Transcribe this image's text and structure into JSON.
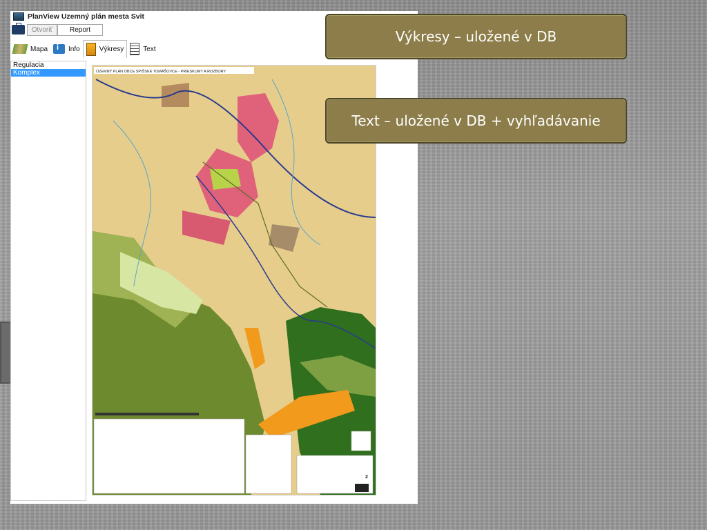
{
  "window": {
    "title": "PlanView Uzemný plán mesta Svit"
  },
  "toolbar": {
    "open_label": "Otvoriť",
    "report_label": "Report"
  },
  "tabs": [
    {
      "label": "Mapa",
      "icon": "map-icon"
    },
    {
      "label": "Info",
      "icon": "info-icon"
    },
    {
      "label": "Výkresy",
      "icon": "drawings-icon",
      "active": true
    },
    {
      "label": "Text",
      "icon": "text-icon"
    }
  ],
  "drawing_list": {
    "items": [
      "Regulacia",
      "Komplex"
    ],
    "selected": "Komplex"
  },
  "drawing": {
    "title": "ÚZEMNÝ PLÁN OBCE SPIŠSKÉ TOMÁŠOVCE - PRIESKUMY A ROZBORY",
    "sheet_number": "2"
  },
  "callouts": {
    "drawings": "Výkresy – uložené v DB",
    "text": "Text – uložené v DB + vyhľadávanie"
  },
  "colors": {
    "callout_fill": "#8c7d4a",
    "callout_border": "#4b4628",
    "selection": "#3399ff"
  }
}
